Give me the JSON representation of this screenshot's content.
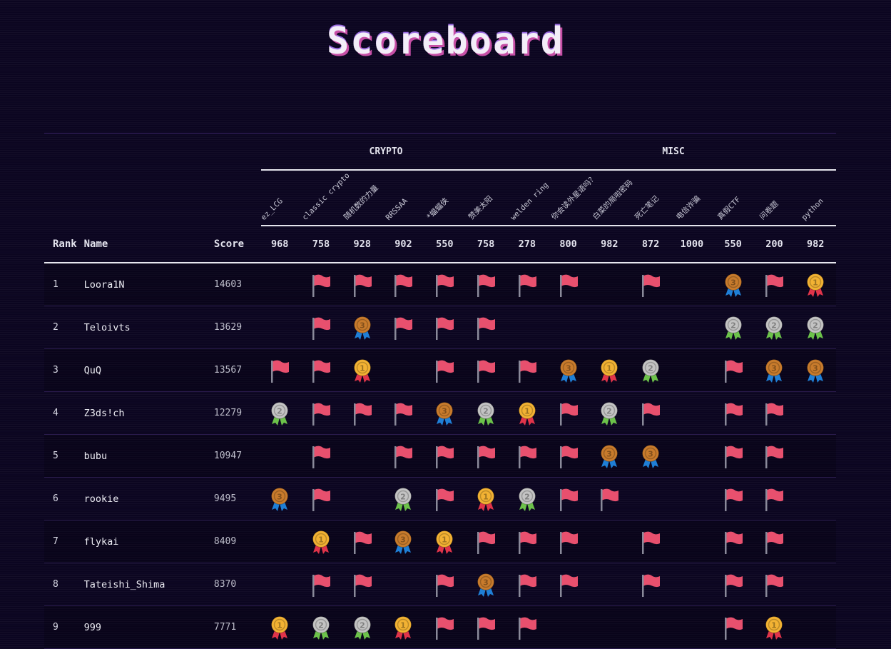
{
  "title": "Scoreboard",
  "categories": [
    "CRYPTO",
    "MISC"
  ],
  "header": {
    "rank": "Rank",
    "name": "Name",
    "score": "Score"
  },
  "challenges": [
    {
      "name": "ez_LCG",
      "points": "968"
    },
    {
      "name": "classic crypto",
      "points": "758"
    },
    {
      "name": "随机数的力量",
      "points": "928"
    },
    {
      "name": "RRSSAA",
      "points": "902"
    },
    {
      "name": "*蝠蝠侠",
      "points": "550"
    },
    {
      "name": "赞美太阳",
      "points": "758"
    },
    {
      "name": "welden ring",
      "points": "278"
    },
    {
      "name": "你会读外星语吗？",
      "points": "800"
    },
    {
      "name": "白菜的局啦密码",
      "points": "982"
    },
    {
      "name": "死亡笔记",
      "points": "872"
    },
    {
      "name": "电信诈骗",
      "points": "1000"
    },
    {
      "name": "真假CTF",
      "points": "550"
    },
    {
      "name": "问卷题",
      "points": "200"
    },
    {
      "name": "python",
      "points": "982"
    }
  ],
  "rows": [
    {
      "rank": "1",
      "name": "Loora1N",
      "score": "14603",
      "solves": [
        "",
        "flag",
        "flag",
        "flag",
        "flag",
        "flag",
        "flag",
        "flag",
        "",
        "flag",
        "",
        "bronze-medal",
        "flag",
        "gold-medal"
      ]
    },
    {
      "rank": "2",
      "name": "Teloivts",
      "score": "13629",
      "solves": [
        "",
        "flag",
        "bronze-medal",
        "flag",
        "flag",
        "flag",
        "",
        "",
        "",
        "",
        "",
        "silver-medal",
        "silver-medal",
        "silver-medal"
      ]
    },
    {
      "rank": "3",
      "name": "QuQ",
      "score": "13567",
      "solves": [
        "flag",
        "flag",
        "gold-medal",
        "",
        "flag",
        "flag",
        "flag",
        "bronze-medal",
        "gold-medal",
        "silver-medal",
        "",
        "flag",
        "bronze-medal",
        "bronze-medal"
      ]
    },
    {
      "rank": "4",
      "name": "Z3ds!ch",
      "score": "12279",
      "solves": [
        "silver-medal",
        "flag",
        "flag",
        "flag",
        "bronze-medal",
        "silver-medal",
        "gold-medal",
        "flag",
        "silver-medal",
        "flag",
        "",
        "flag",
        "flag",
        ""
      ]
    },
    {
      "rank": "5",
      "name": "bubu",
      "score": "10947",
      "solves": [
        "",
        "flag",
        "",
        "flag",
        "flag",
        "flag",
        "flag",
        "flag",
        "bronze-medal",
        "bronze-medal",
        "",
        "flag",
        "flag",
        ""
      ]
    },
    {
      "rank": "6",
      "name": "rookie",
      "score": "9495",
      "solves": [
        "bronze-medal",
        "flag",
        "",
        "silver-medal",
        "flag",
        "gold-medal",
        "silver-medal",
        "flag",
        "flag",
        "",
        "",
        "flag",
        "flag",
        ""
      ]
    },
    {
      "rank": "7",
      "name": "flykai",
      "score": "8409",
      "solves": [
        "",
        "gold-medal",
        "flag",
        "bronze-medal",
        "gold-medal",
        "flag",
        "flag",
        "flag",
        "",
        "flag",
        "",
        "flag",
        "flag",
        ""
      ]
    },
    {
      "rank": "8",
      "name": "Tateishi_Shima",
      "score": "8370",
      "solves": [
        "",
        "flag",
        "flag",
        "",
        "flag",
        "bronze-medal",
        "flag",
        "flag",
        "",
        "flag",
        "",
        "flag",
        "flag",
        ""
      ]
    },
    {
      "rank": "9",
      "name": "999",
      "score": "7771",
      "solves": [
        "gold-medal",
        "silver-medal",
        "silver-medal",
        "gold-medal",
        "flag",
        "flag",
        "flag",
        "",
        "",
        "",
        "",
        "flag",
        "gold-medal",
        ""
      ]
    }
  ],
  "colors": {
    "background": "#0b0520",
    "flag": "#e8506e",
    "gold": "#f2b233",
    "silver": "#c3c3c3",
    "bronze": "#c87b2c"
  }
}
